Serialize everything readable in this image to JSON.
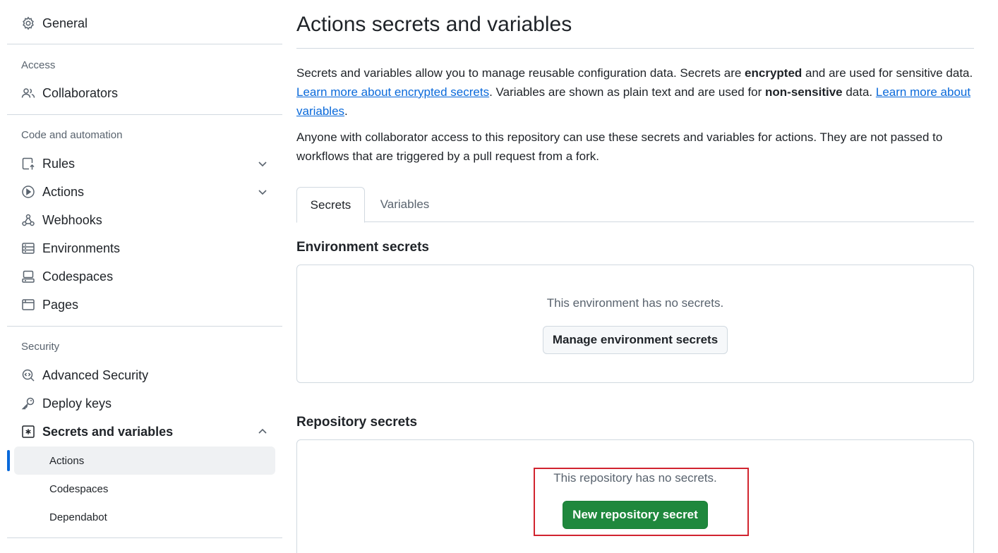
{
  "sidebar": {
    "general": "General",
    "access_label": "Access",
    "collaborators": "Collaborators",
    "code_label": "Code and automation",
    "rules": "Rules",
    "actions": "Actions",
    "webhooks": "Webhooks",
    "environments": "Environments",
    "codespaces": "Codespaces",
    "pages": "Pages",
    "security_label": "Security",
    "advanced_security": "Advanced Security",
    "deploy_keys": "Deploy keys",
    "secrets_and_variables": "Secrets and variables",
    "sub_items": [
      "Actions",
      "Codespaces",
      "Dependabot"
    ]
  },
  "main": {
    "title": "Actions secrets and variables",
    "desc": {
      "p1_a": "Secrets and variables allow you to manage reusable configuration data. Secrets are ",
      "p1_b": "encrypted",
      "p1_c": " and are used for sensitive data. ",
      "link1": "Learn more about encrypted secrets",
      "p1_d": ". Variables are shown as plain text and are used for ",
      "p1_e": "non-sensitive",
      "p1_f": " data. ",
      "link2": "Learn more about variables",
      "p1_g": ".",
      "p2": "Anyone with collaborator access to this repository can use these secrets and variables for actions. They are not passed to workflows that are triggered by a pull request from a fork."
    },
    "tabs": [
      "Secrets",
      "Variables"
    ],
    "env_section": {
      "title": "Environment secrets",
      "empty": "This environment has no secrets.",
      "button": "Manage environment secrets"
    },
    "repo_section": {
      "title": "Repository secrets",
      "empty": "This repository has no secrets.",
      "button": "New repository secret"
    }
  },
  "colors": {
    "accent": "#0969da",
    "primary_button": "#1f883d",
    "highlight": "#d1242f"
  }
}
